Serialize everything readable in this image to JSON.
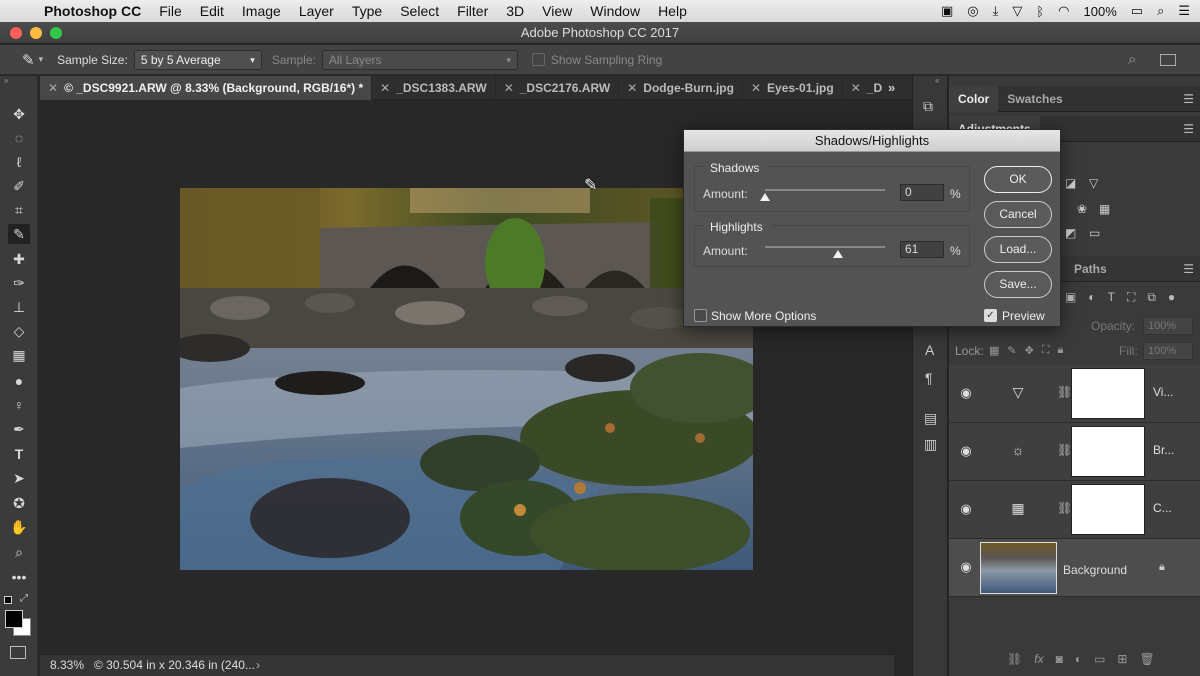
{
  "menubar": {
    "app": "Photoshop CC",
    "items": [
      "File",
      "Edit",
      "Image",
      "Layer",
      "Type",
      "Select",
      "Filter",
      "3D",
      "View",
      "Window",
      "Help"
    ],
    "battery": "100%"
  },
  "window": {
    "title": "Adobe Photoshop CC 2017"
  },
  "options": {
    "sample_size_label": "Sample Size:",
    "sample_size_value": "5 by 5 Average",
    "sample_label": "Sample:",
    "sample_value": "All Layers",
    "show_ring": "Show Sampling Ring"
  },
  "tabs": [
    {
      "label": "© _DSC9921.ARW @ 8.33% (Background, RGB/16*) *"
    },
    {
      "label": "_DSC1383.ARW"
    },
    {
      "label": "_DSC2176.ARW"
    },
    {
      "label": "Dodge-Burn.jpg"
    },
    {
      "label": "Eyes-01.jpg"
    },
    {
      "label": "_D"
    }
  ],
  "status": {
    "zoom": "8.33%",
    "docsize": "© 30.504 in x 20.346 in (240..."
  },
  "panels": {
    "top_tabs": [
      "Color",
      "Swatches"
    ],
    "adjustments_label": "Adjustments",
    "paths_tab": "Paths",
    "opacity_label": "Opacity:",
    "opacity_value": "100%",
    "lock_label": "Lock:",
    "fill_label": "Fill:",
    "fill_value": "100%"
  },
  "layers": [
    {
      "name": "Vi...",
      "icon": "vibrance-icon"
    },
    {
      "name": "Br...",
      "icon": "brightness-icon"
    },
    {
      "name": "C...",
      "icon": "curves-icon"
    },
    {
      "name": "Background",
      "icon": "photo-thumbnail"
    }
  ],
  "dialog": {
    "title": "Shadows/Highlights",
    "shadows_label": "Shadows",
    "highlights_label": "Highlights",
    "amount_label": "Amount:",
    "shadows_amount": "0",
    "shadows_fraction": 0,
    "highlights_amount": "61",
    "highlights_fraction": 0.61,
    "percent": "%",
    "ok": "OK",
    "cancel": "Cancel",
    "load": "Load...",
    "save": "Save...",
    "more_options": "Show More Options",
    "preview": "Preview",
    "preview_checked": true
  }
}
